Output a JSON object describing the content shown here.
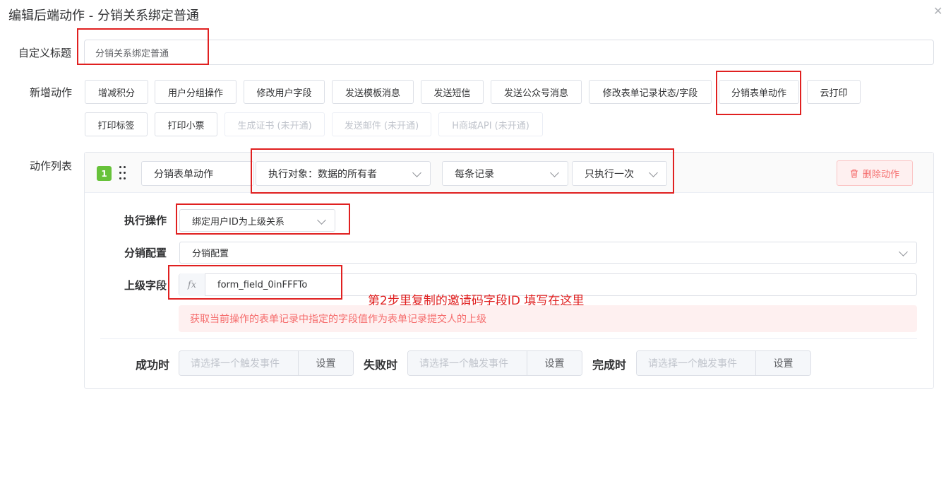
{
  "dialog": {
    "title": "编辑后端动作 - 分销关系绑定普通",
    "close_icon": "close-icon"
  },
  "custom_title": {
    "label": "自定义标题",
    "value": "分销关系绑定普通"
  },
  "new_action": {
    "label": "新增动作",
    "buttons": [
      {
        "label": "增减积分",
        "disabled": false
      },
      {
        "label": "用户分组操作",
        "disabled": false
      },
      {
        "label": "修改用户字段",
        "disabled": false
      },
      {
        "label": "发送模板消息",
        "disabled": false
      },
      {
        "label": "发送短信",
        "disabled": false
      },
      {
        "label": "发送公众号消息",
        "disabled": false
      },
      {
        "label": "修改表单记录状态/字段",
        "disabled": false
      },
      {
        "label": "分销表单动作",
        "disabled": false
      },
      {
        "label": "云打印",
        "disabled": false
      },
      {
        "label": "打印标签",
        "disabled": false
      },
      {
        "label": "打印小票",
        "disabled": false
      },
      {
        "label": "生成证书 (未开通)",
        "disabled": true
      },
      {
        "label": "发送邮件 (未开通)",
        "disabled": true
      },
      {
        "label": "H商城API (未开通)",
        "disabled": true
      }
    ]
  },
  "action_list": {
    "label": "动作列表",
    "item": {
      "index": "1",
      "action_name": "分销表单动作",
      "target": "执行对象：数据的所有者",
      "frequency": "每条记录",
      "repeat": "只执行一次",
      "delete_label": "删除动作",
      "delete_icon": "trash-icon"
    },
    "exec": {
      "label": "执行操作",
      "value": "绑定用户ID为上级关系"
    },
    "config": {
      "label": "分销配置",
      "value": "分销配置"
    },
    "parent_field": {
      "label": "上级字段",
      "fx": "fx",
      "value": "form_field_0inFFFTo"
    },
    "hint": "获取当前操作的表单记录中指定的字段值作为表单记录提交人的上级",
    "events": [
      {
        "label": "成功时",
        "placeholder": "请选择一个触发事件",
        "button": "设置"
      },
      {
        "label": "失败时",
        "placeholder": "请选择一个触发事件",
        "button": "设置"
      },
      {
        "label": "完成时",
        "placeholder": "请选择一个触发事件",
        "button": "设置"
      }
    ]
  },
  "annotation": "第2步里复制的邀请码字段ID 填写在这里",
  "colors": {
    "annotation_red": "#e02020",
    "success_green": "#67c23a",
    "danger": "#f56c6c"
  }
}
